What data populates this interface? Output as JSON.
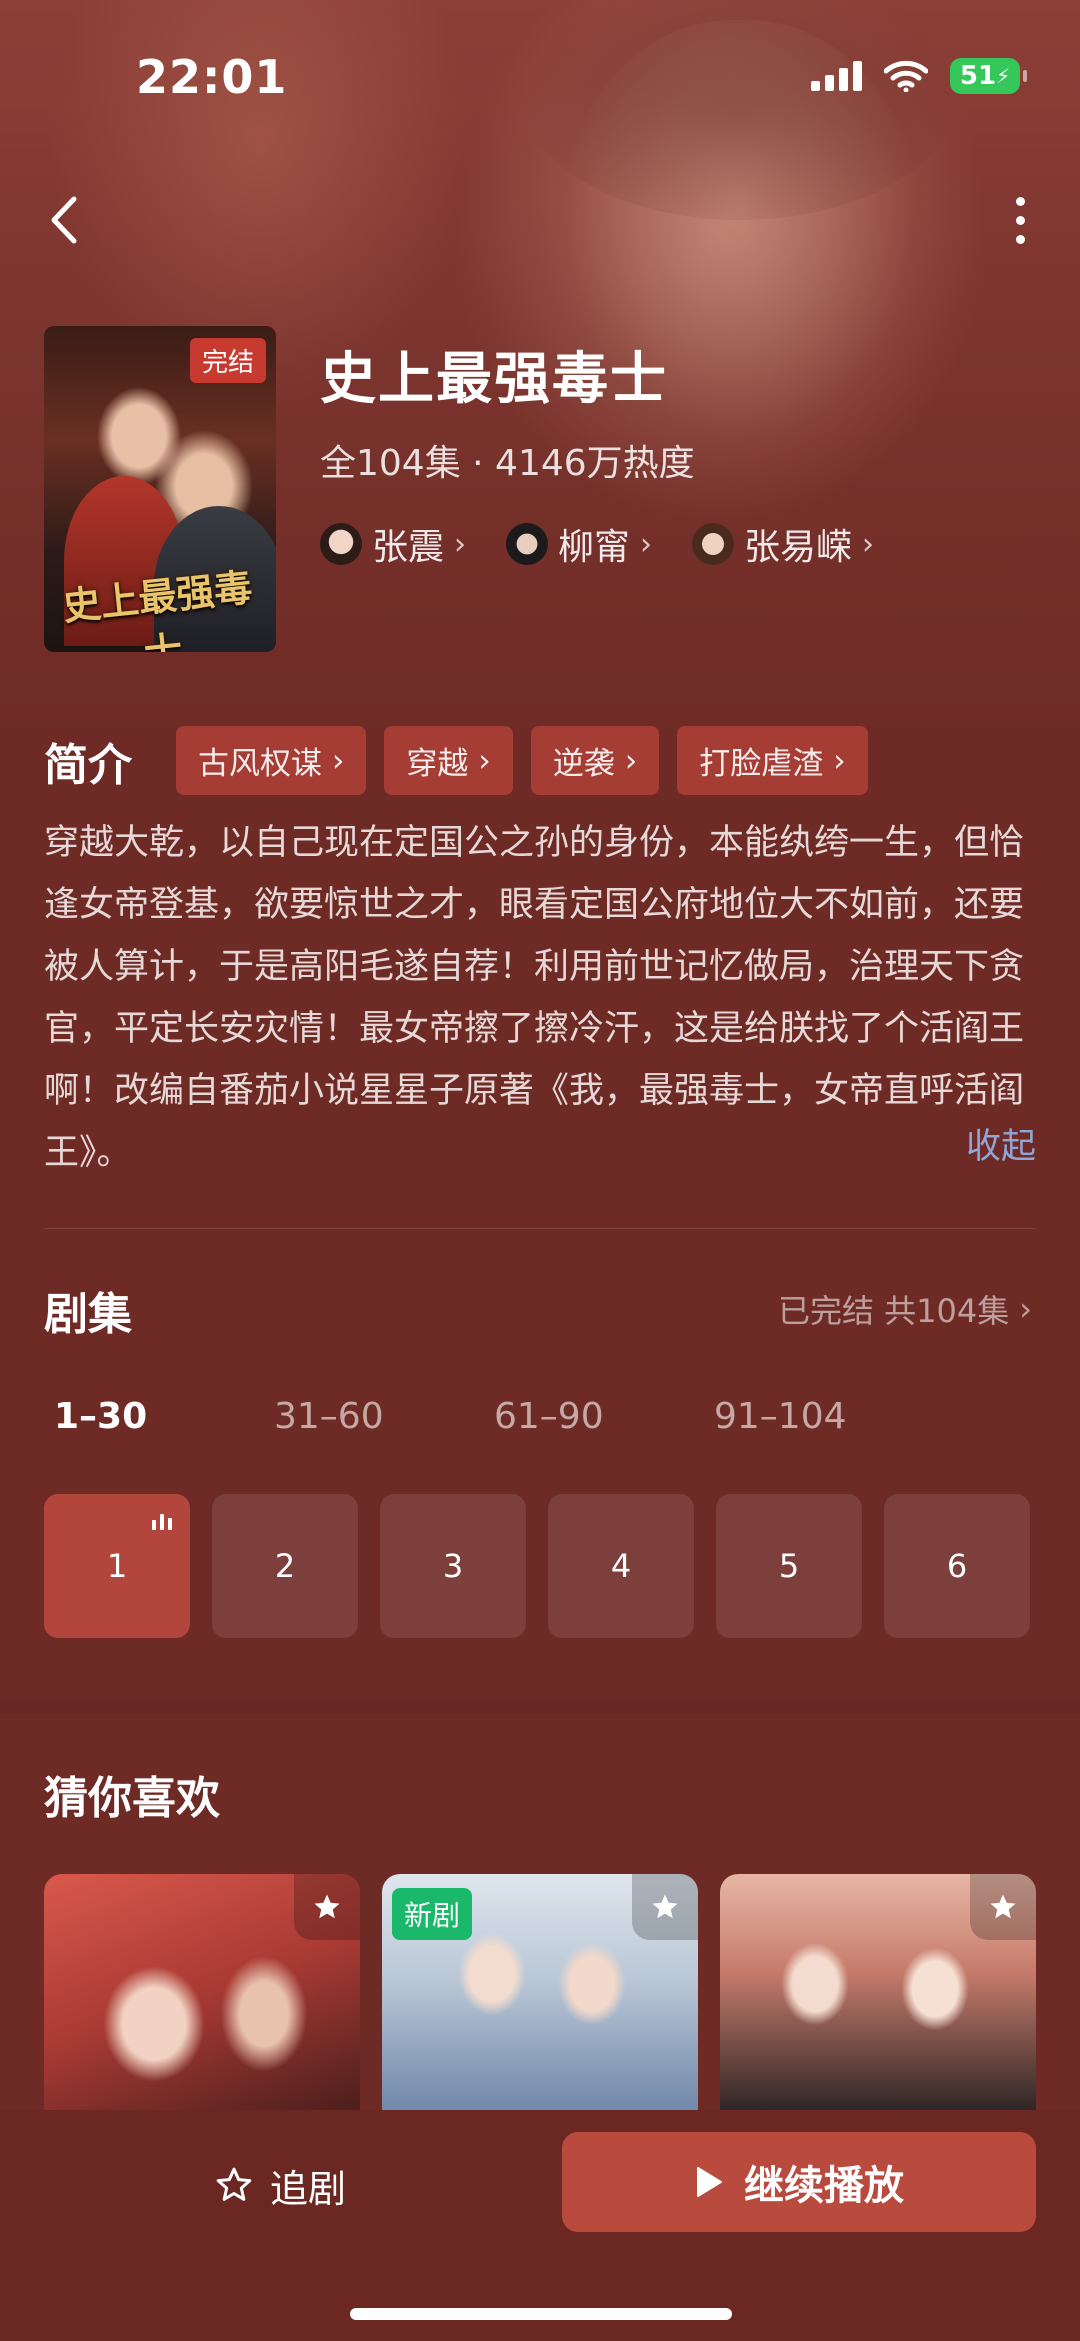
{
  "status_bar": {
    "time": "22:01",
    "battery": "51"
  },
  "show": {
    "title": "史上最强毒士",
    "meta": "全104集 · 4146万热度",
    "poster_badge": "完结",
    "poster_title": "史上最强毒士",
    "cast": [
      {
        "name": "张震"
      },
      {
        "name": "柳甯"
      },
      {
        "name": "张易嵘"
      }
    ]
  },
  "intro": {
    "label": "简介",
    "tags": [
      "古风权谋",
      "穿越",
      "逆袭",
      "打脸虐渣"
    ],
    "synopsis": "穿越大乾，以自己现在定国公之孙的身份，本能纨绔一生，但恰逢女帝登基，欲要惊世之才，眼看定国公府地位大不如前，还要被人算计，于是高阳毛遂自荐！利用前世记忆做局，治理天下贪官，平定长安灾情！最女帝擦了擦冷汗，这是给朕找了个活阎王啊！改编自番茄小说星星子原著《我，最强毒士，女帝直呼活阎王》。",
    "collapse_label": "收起"
  },
  "episodes": {
    "label": "剧集",
    "status": "已完结 共104集",
    "ranges": [
      "1–30",
      "31–60",
      "61–90",
      "91–104"
    ],
    "active_range": 0,
    "items": [
      "1",
      "2",
      "3",
      "4",
      "5",
      "6"
    ],
    "current": "1"
  },
  "recommend": {
    "label": "猜你喜欢",
    "cards": [
      {
        "badge": ""
      },
      {
        "badge": "新剧"
      },
      {
        "badge": ""
      }
    ]
  },
  "bottom": {
    "follow_label": "追剧",
    "play_label": "继续播放"
  },
  "colors": {
    "background": "#6e2a25",
    "accent": "#b84a3e",
    "link": "#8fa6d6",
    "new_badge": "#19b86a"
  }
}
